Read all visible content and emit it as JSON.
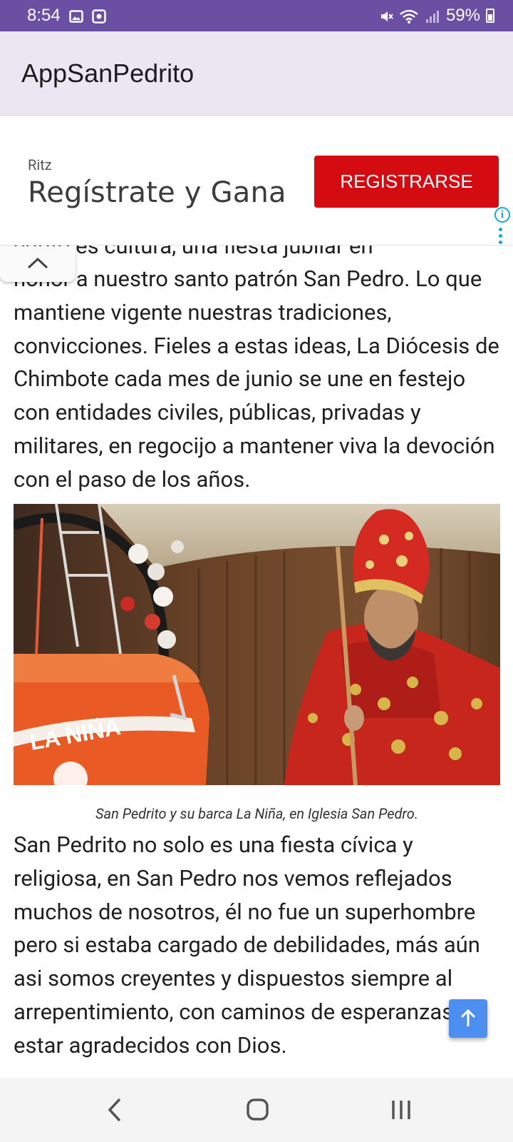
{
  "status_bar": {
    "time": "8:54",
    "battery": "59%",
    "icons": [
      "image-icon",
      "record-icon",
      "mute-icon",
      "wifi-icon",
      "signal-icon",
      "battery-icon"
    ]
  },
  "app_bar": {
    "title": "AppSanPedrito"
  },
  "ad": {
    "brand": "Ritz",
    "headline": "Regístrate y Gana",
    "cta": "REGISTRARSE",
    "info_glyph": "i"
  },
  "article": {
    "paragraph_1_partial_top": "edrito es cultura, una fiesta jubilar en",
    "paragraph_1": "honor a nuestro santo patrón San Pedro. Lo que mantiene vigente nuestras tradiciones, convicciones. Fieles a estas ideas, La Diócesis de Chimbote cada mes de junio se une en festejo con entidades civiles, públicas, privadas y militares, en regocijo a mantener viva la devoción con el paso de los años.",
    "image_caption": "San Pedrito y su barca La Niña, en Iglesia San Pedro.",
    "image_boat_text": "LA NIÑA",
    "paragraph_2": "San Pedrito no solo es una fiesta cívica y religiosa, en San Pedro nos vemos reflejados muchos de nosotros, él no fue un superhombre pero si estaba cargado de debilidades, más aún asi somos creyentes y dispuestos siempre al arrepentimiento, con caminos de esperanzas y estar agradecidos con Dios."
  },
  "colors": {
    "status_bar": "#6a4fa3",
    "app_bar": "#ece6f2",
    "ad_cta": "#d50b12",
    "fab": "#4d8ff0",
    "ad_info": "#19a7d2"
  }
}
